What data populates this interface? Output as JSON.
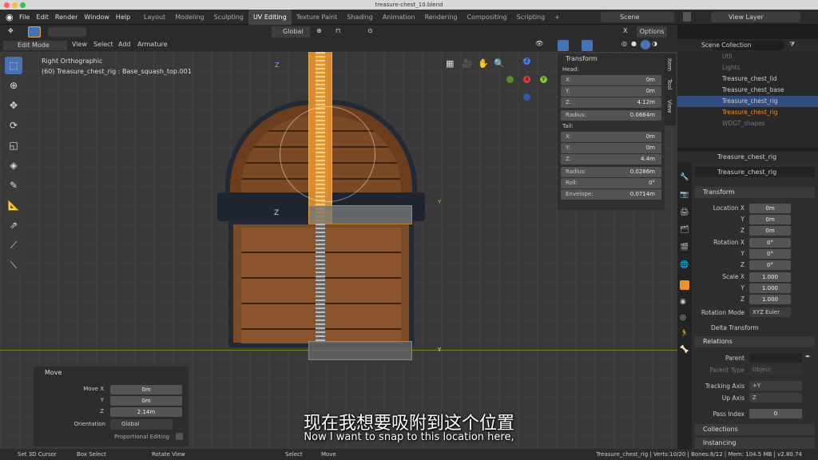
{
  "window": {
    "title": "treasure-chest_10.blend"
  },
  "menu": [
    "File",
    "Edit",
    "Render",
    "Window",
    "Help"
  ],
  "workspaces": [
    "Layout",
    "Modeling",
    "Sculpting",
    "UV Editing",
    "Texture Paint",
    "Shading",
    "Animation",
    "Rendering",
    "Compositing",
    "Scripting"
  ],
  "active_workspace": "UV Editing",
  "scene": {
    "label": "Scene",
    "view_layer": "View Layer"
  },
  "toolbar": {
    "orientation": "Global",
    "options": "Options"
  },
  "header": {
    "mode": "Edit Mode",
    "items": [
      "View",
      "Select",
      "Add",
      "Armature"
    ]
  },
  "viewport": {
    "view_name": "Right Orthographic",
    "object_info": "(60) Treasure_chest_rig : Base_squash_top.001",
    "sidetabs": [
      "Item",
      "Tool",
      "View"
    ],
    "axes": {
      "z": "Z",
      "y": "Y",
      "x": "X"
    }
  },
  "transform_panel": {
    "title": "Transform",
    "head_label": "Head:",
    "head": [
      {
        "l": "X:",
        "v": "0m"
      },
      {
        "l": "Y:",
        "v": "0m"
      },
      {
        "l": "Z:",
        "v": "4.12m"
      }
    ],
    "radius_head": {
      "l": "Radius:",
      "v": "0.0664m"
    },
    "tail_label": "Tail:",
    "tail": [
      {
        "l": "X:",
        "v": "0m"
      },
      {
        "l": "Y:",
        "v": "0m"
      },
      {
        "l": "Z:",
        "v": "4.4m"
      }
    ],
    "radius_tail": {
      "l": "Radius:",
      "v": "0.0286m"
    },
    "roll": {
      "l": "Roll:",
      "v": "0°"
    },
    "envelope": {
      "l": "Envelope:",
      "v": "0.0714m"
    }
  },
  "outliner": {
    "items": [
      {
        "name": "Scene Collection"
      },
      {
        "name": "Util"
      },
      {
        "name": "Lights"
      },
      {
        "name": "Treasure_chest_lid"
      },
      {
        "name": "Treasure_chest_base"
      },
      {
        "name": "Treasure_chest_rig"
      },
      {
        "name": "Treasure_chest_rig"
      },
      {
        "name": "WDGT_shapes"
      }
    ]
  },
  "properties": {
    "object_name": "Treasure_chest_rig",
    "data_name": "Treasure_chest_rig",
    "transform_title": "Transform",
    "location": [
      {
        "l": "Location X",
        "v": "0m"
      },
      {
        "l": "Y",
        "v": "0m"
      },
      {
        "l": "Z",
        "v": "0m"
      }
    ],
    "rotation": [
      {
        "l": "Rotation X",
        "v": "0°"
      },
      {
        "l": "Y",
        "v": "0°"
      },
      {
        "l": "Z",
        "v": "0°"
      }
    ],
    "scale": [
      {
        "l": "Scale X",
        "v": "1.000"
      },
      {
        "l": "Y",
        "v": "1.000"
      },
      {
        "l": "Z",
        "v": "1.000"
      }
    ],
    "rotation_mode_label": "Rotation Mode",
    "rotation_mode": "XYZ Euler",
    "delta": "Delta Transform",
    "relations": "Relations",
    "parent_label": "Parent",
    "parent_type_label": "Parent Type",
    "parent_type": "Object",
    "tracking_label": "Tracking Axis",
    "tracking": "+Y",
    "up_label": "Up Axis",
    "up": "Z",
    "pass_label": "Pass Index",
    "pass": "0",
    "collections": "Collections",
    "instancing": "Instancing"
  },
  "move_panel": {
    "title": "Move",
    "rows": [
      {
        "l": "Move X",
        "v": "0m"
      },
      {
        "l": "Y",
        "v": "0m"
      },
      {
        "l": "Z",
        "v": "2.14m"
      }
    ],
    "orientation_label": "Orientation",
    "orientation": "Global",
    "proportional": "Proportional Editing"
  },
  "status": {
    "left": [
      "Set 3D Cursor",
      "Box Select",
      "Rotate View"
    ],
    "mid": [
      "Select",
      "Move"
    ],
    "right": "Treasure_chest_rig | Verts:10/20 | Bones:6/12 | Mem: 104.5 MB | v2.80.74"
  },
  "subtitles": {
    "cn": "现在我想要吸附到这个位置",
    "en": "Now I want to snap to this location here,"
  }
}
